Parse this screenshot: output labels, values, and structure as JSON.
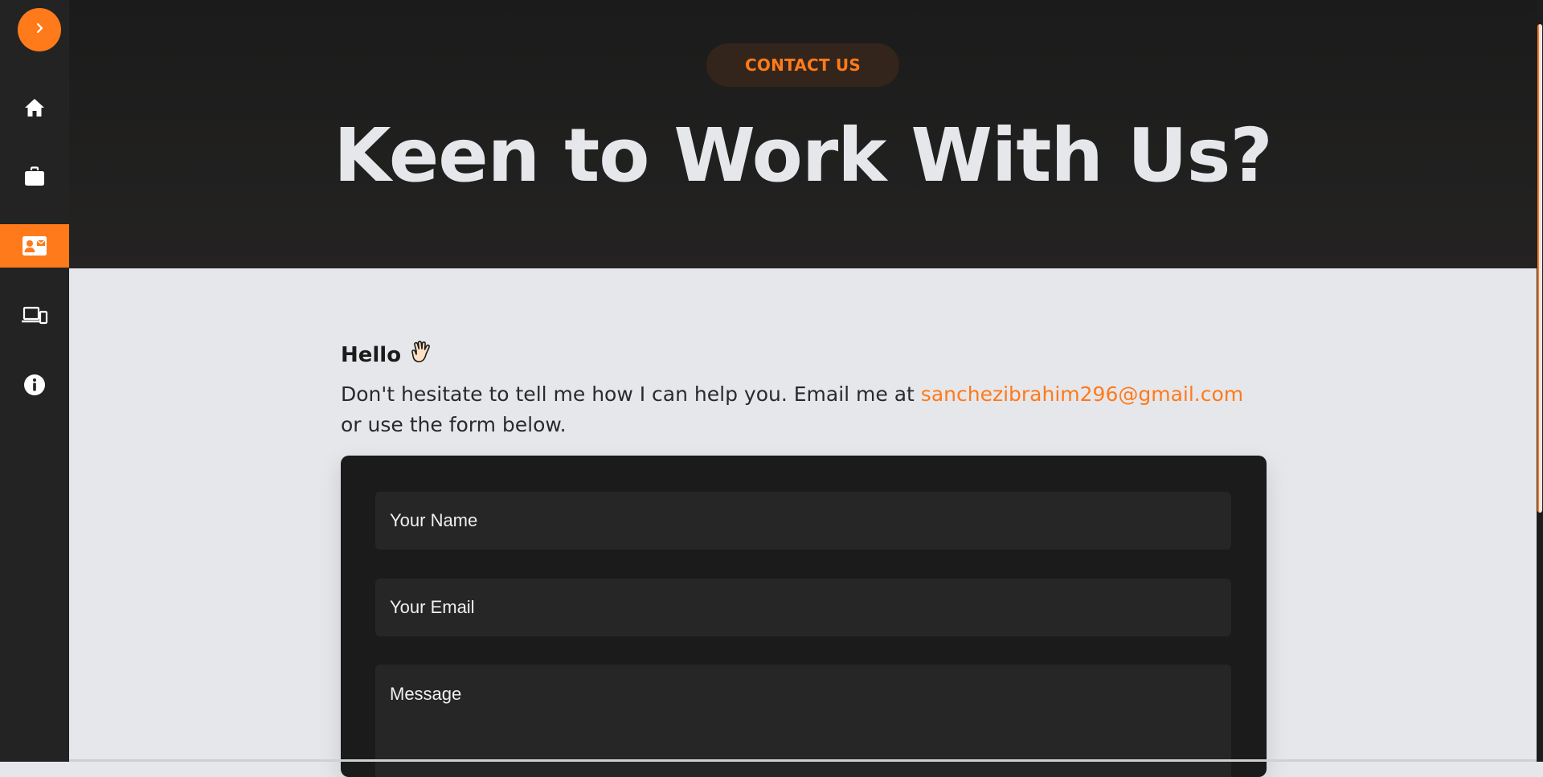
{
  "sidebar": {
    "toggle_icon": "chevron-right-icon",
    "items": [
      {
        "icon": "home-icon",
        "active": false
      },
      {
        "icon": "briefcase-icon",
        "active": false
      },
      {
        "icon": "contact-card-icon",
        "active": true
      },
      {
        "icon": "devices-icon",
        "active": false
      },
      {
        "icon": "info-icon",
        "active": false
      }
    ]
  },
  "hero": {
    "badge": "CONTACT US",
    "title": "Keen to Work With Us?"
  },
  "content": {
    "greeting": "Hello",
    "greeting_icon": "waving-hand-icon",
    "intro_before": "Don't hesitate to tell me how I can help you. Email me at ",
    "email": "sanchezibrahim296@gmail.com",
    "intro_after": " or use the form below."
  },
  "form": {
    "name_placeholder": "Your Name",
    "email_placeholder": "Your Email",
    "message_placeholder": "Message"
  },
  "colors": {
    "accent": "#ff7a1a",
    "sidebar": "#232323",
    "hero_bg": "#1b1b1b",
    "page_bg": "#e6e7eb",
    "card_bg": "#1b1b1b",
    "field_bg": "#262626"
  }
}
